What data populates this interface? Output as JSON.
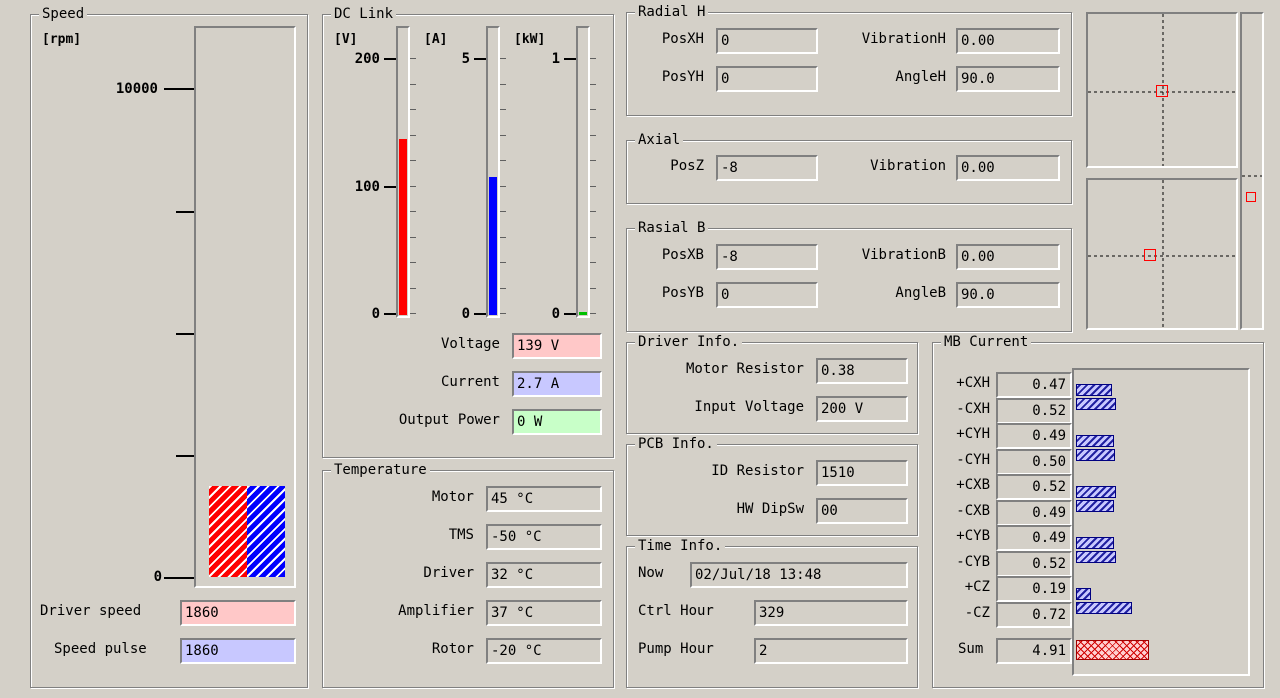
{
  "speed": {
    "title": "Speed",
    "unit": "[rpm]",
    "tick_max_label": "10000",
    "tick_min_label": "0",
    "driver_speed_label": "Driver speed",
    "driver_speed_value": "1860",
    "speed_pulse_label": "Speed pulse",
    "speed_pulse_value": "1860",
    "bar_value_rpm": 1860,
    "scale_max_rpm": 10000
  },
  "dc_link": {
    "title": "DC Link",
    "voltage_unit": "[V]",
    "current_unit": "[A]",
    "power_unit": "[kW]",
    "voltage_ticks": [
      "200",
      "100",
      "0"
    ],
    "current_ticks": [
      "5",
      "0"
    ],
    "power_ticks": [
      "1",
      "0"
    ],
    "voltage_label": "Voltage",
    "voltage_value": "139 V",
    "current_label": "Current",
    "current_value": "2.7 A",
    "power_label": "Output Power",
    "power_value": "0 W",
    "voltage_fraction": 0.69,
    "current_fraction": 0.54,
    "power_fraction": 0.01
  },
  "temperature": {
    "title": "Temperature",
    "motor_label": "Motor",
    "motor_value": "45 °C",
    "tms_label": "TMS",
    "tms_value": "-50 °C",
    "driver_label": "Driver",
    "driver_value": "32 °C",
    "amplifier_label": "Amplifier",
    "amplifier_value": "37 °C",
    "rotor_label": "Rotor",
    "rotor_value": "-20 °C"
  },
  "radial_h": {
    "title": "Radial H",
    "posx_label": "PosXH",
    "posx_value": "0",
    "posy_label": "PosYH",
    "posy_value": "0",
    "vibration_label": "VibrationH",
    "vibration_value": "0.00",
    "angle_label": "AngleH",
    "angle_value": "90.0"
  },
  "axial": {
    "title": "Axial",
    "posz_label": "PosZ",
    "posz_value": "-8",
    "vibration_label": "Vibration",
    "vibration_value": "0.00"
  },
  "radial_b": {
    "title": "Rasial B",
    "posx_label": "PosXB",
    "posx_value": "-8",
    "posy_label": "PosYB",
    "posy_value": "0",
    "vibration_label": "VibrationB",
    "vibration_value": "0.00",
    "angle_label": "AngleB",
    "angle_value": "90.0"
  },
  "driver_info": {
    "title": "Driver Info.",
    "motor_resistor_label": "Motor Resistor",
    "motor_resistor_value": "0.38",
    "input_voltage_label": "Input Voltage",
    "input_voltage_value": "200 V"
  },
  "pcb_info": {
    "title": "PCB Info.",
    "id_resistor_label": "ID Resistor",
    "id_resistor_value": "1510",
    "hw_dipsw_label": "HW DipSw",
    "hw_dipsw_value": "00"
  },
  "time_info": {
    "title": "Time Info.",
    "now_label": "Now",
    "now_value": "02/Jul/18 13:48",
    "ctrl_hour_label": "Ctrl Hour",
    "ctrl_hour_value": "329",
    "pump_hour_label": "Pump Hour",
    "pump_hour_value": "2"
  },
  "mb_current": {
    "title": "MB Current",
    "rows": [
      {
        "label": "+CXH",
        "value": "0.47"
      },
      {
        "label": "-CXH",
        "value": "0.52"
      },
      {
        "label": "+CYH",
        "value": "0.49"
      },
      {
        "label": "-CYH",
        "value": "0.50"
      },
      {
        "label": "+CXB",
        "value": "0.52"
      },
      {
        "label": "-CXB",
        "value": "0.49"
      },
      {
        "label": "+CYB",
        "value": "0.49"
      },
      {
        "label": "-CYB",
        "value": "0.52"
      },
      {
        "label": "+CZ",
        "value": "0.19"
      },
      {
        "label": "-CZ",
        "value": "0.72"
      }
    ],
    "sum_label": "Sum",
    "sum_value": "4.91",
    "bar_scale_max": 2.2
  },
  "colors": {
    "background": "#d4d0c8",
    "voltage_bar": "#ff0000",
    "current_bar": "#0000ff",
    "power_bar": "#00c000",
    "marker": "#ff0000"
  }
}
